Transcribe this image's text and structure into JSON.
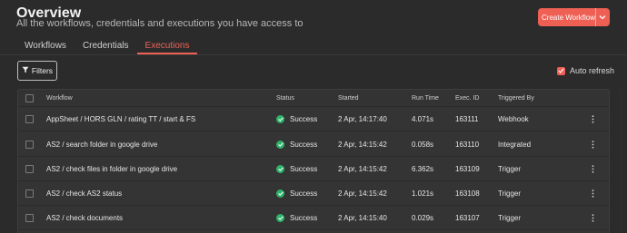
{
  "header": {
    "title": "Overview",
    "subtitle": "All the workflows, credentials and executions you have access to",
    "create_button": "Create Workflow"
  },
  "tabs": [
    {
      "label": "Workflows",
      "active": false
    },
    {
      "label": "Credentials",
      "active": false
    },
    {
      "label": "Executions",
      "active": true
    }
  ],
  "toolbar": {
    "filters_label": "Filters",
    "auto_refresh_label": "Auto refresh",
    "auto_refresh_checked": true
  },
  "table": {
    "columns": {
      "workflow": "Workflow",
      "status": "Status",
      "started": "Started",
      "run_time": "Run Time",
      "exec_id": "Exec. ID",
      "triggered_by": "Triggered By"
    },
    "rows": [
      {
        "workflow": "AppSheet / HORS GLN / rating TT / start & FS",
        "status": "Success",
        "started": "2 Apr, 14:17:40",
        "run_time": "4.071s",
        "exec_id": "163111",
        "triggered_by": "Webhook"
      },
      {
        "workflow": "AS2 / search folder in google drive",
        "status": "Success",
        "started": "2 Apr, 14:15:42",
        "run_time": "0.058s",
        "exec_id": "163110",
        "triggered_by": "Integrated"
      },
      {
        "workflow": "AS2 / check files in folder in google drive",
        "status": "Success",
        "started": "2 Apr, 14:15:42",
        "run_time": "6.362s",
        "exec_id": "163109",
        "triggered_by": "Trigger"
      },
      {
        "workflow": "AS2 / check AS2 status",
        "status": "Success",
        "started": "2 Apr, 14:15:42",
        "run_time": "1.021s",
        "exec_id": "163108",
        "triggered_by": "Trigger"
      },
      {
        "workflow": "AS2 / check documents",
        "status": "Success",
        "started": "2 Apr, 14:15:40",
        "run_time": "0.029s",
        "exec_id": "163107",
        "triggered_by": "Trigger"
      }
    ]
  },
  "colors": {
    "accent": "#ee5f54",
    "success": "#2fb36b",
    "background": "#2b2b2b"
  }
}
